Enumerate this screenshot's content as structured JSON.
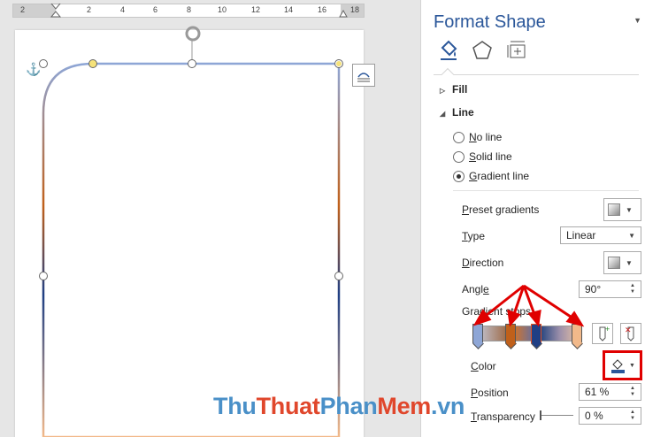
{
  "ruler": {
    "labels": [
      "2",
      "2",
      "4",
      "6",
      "8",
      "10",
      "12",
      "14",
      "16",
      "18"
    ]
  },
  "pane": {
    "title": "Format Shape",
    "sections": {
      "fill": "Fill",
      "line": "Line"
    },
    "line_options": {
      "no_line": {
        "u": "N",
        "rest": "o line"
      },
      "solid_line": {
        "u": "S",
        "rest": "olid line"
      },
      "gradient_line": {
        "u": "G",
        "rest": "radient line"
      },
      "selected": "gradient_line"
    },
    "preset_gradients": {
      "u": "P",
      "rest": "reset gradients"
    },
    "type": {
      "label_u": "T",
      "label_rest": "ype",
      "value": "Linear"
    },
    "direction": {
      "u": "D",
      "rest": "irection"
    },
    "angle": {
      "label_pre": "Angl",
      "label_u": "e",
      "value": "90°"
    },
    "gradient_stops": {
      "label": "Gradient stops",
      "stop_colors": [
        "#8ea6d6",
        "#c0601a",
        "#1f3f84",
        "#f2b98a"
      ]
    },
    "color": {
      "label_pre": "",
      "label_u": "C",
      "label_rest": "olor",
      "swatch": "#2b579a"
    },
    "position": {
      "label_u": "P",
      "label_rest": "osition",
      "value": "61 %"
    },
    "transparency": {
      "label_u": "T",
      "label_rest": "ransparency",
      "value": "0 %"
    }
  },
  "watermark": {
    "p1": "Thu",
    "p2": "Thuat",
    "p3": "Phan",
    "p4": "Mem",
    "p5": ".vn"
  },
  "colors": {
    "accent": "#2b579a",
    "annotation_red": "#e00000"
  }
}
